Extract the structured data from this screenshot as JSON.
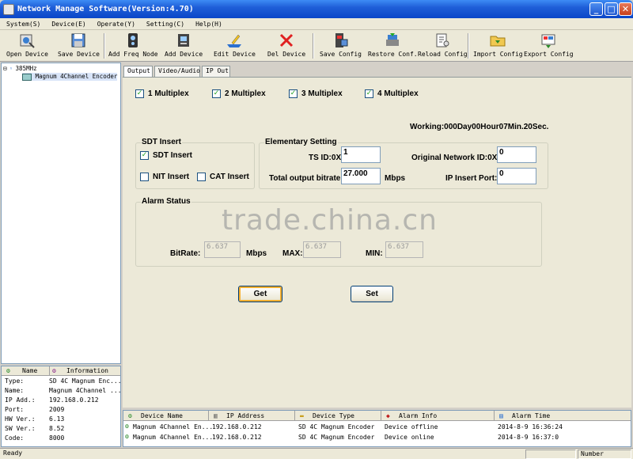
{
  "window": {
    "title": "Network Manage Software(Version:4.70)",
    "controls": [
      "_",
      "□",
      "✕"
    ]
  },
  "menu": [
    "System(S)",
    "Device(E)",
    "Operate(Y)",
    "Setting(C)",
    "Help(H)"
  ],
  "toolbar": [
    {
      "label": "Open Device",
      "icon": "open-device-icon"
    },
    {
      "label": "Save Device",
      "icon": "save-device-icon"
    },
    {
      "label": "Add Freq Node",
      "icon": "add-freq-node-icon"
    },
    {
      "label": "Add Device",
      "icon": "add-device-icon"
    },
    {
      "label": "Edit Device",
      "icon": "edit-device-icon"
    },
    {
      "label": "Del Device",
      "icon": "delete-icon"
    },
    {
      "label": "Save Config",
      "icon": "save-config-icon"
    },
    {
      "label": "Restore Conf.",
      "icon": "restore-config-icon"
    },
    {
      "label": "Reload Config",
      "icon": "reload-config-icon"
    },
    {
      "label": "Import Config",
      "icon": "import-config-icon"
    },
    {
      "label": "Export Config",
      "icon": "export-config-icon"
    }
  ],
  "tree": {
    "root": "385MHz",
    "child": "Magnum 4Channel Encoder",
    "expander": "⊟"
  },
  "info": {
    "col_name": "Name",
    "col_info": "Information",
    "rows": [
      {
        "name": "Type:",
        "value": "SD 4C Magnum Enc..."
      },
      {
        "name": "Name:",
        "value": "Magnum 4Channel ..."
      },
      {
        "name": "IP Add.:",
        "value": "192.168.0.212"
      },
      {
        "name": "Port:",
        "value": "2009"
      },
      {
        "name": "HW Ver.:",
        "value": "6.13"
      },
      {
        "name": "SW Ver.:",
        "value": "8.52"
      },
      {
        "name": "Code:",
        "value": "8000"
      }
    ]
  },
  "tabs": [
    "Output",
    "Video/Audio",
    "IP Out"
  ],
  "output": {
    "multiplex": [
      {
        "label": "1 Multiplex",
        "checked": true
      },
      {
        "label": "2 Multiplex",
        "checked": true
      },
      {
        "label": "3 Multiplex",
        "checked": true
      },
      {
        "label": "4 Multiplex",
        "checked": true
      }
    ],
    "working": "Working:000Day00Hour07Min.20Sec.",
    "sdt_group": "SDT Insert",
    "sdt_insert": {
      "label": "SDT Insert",
      "checked": true
    },
    "nit_insert": {
      "label": "NIT Insert",
      "checked": false
    },
    "cat_insert": {
      "label": "CAT Insert",
      "checked": false
    },
    "elem_group": "Elementary Setting",
    "ts_id_label": "TS ID:0X",
    "ts_id_value": "1",
    "onid_label": "Original Network ID:0X",
    "onid_value": "0",
    "bitrate_label": "Total output bitrate:",
    "bitrate_value": "27.000",
    "bitrate_unit": "Mbps",
    "ip_port_label": "IP Insert Port:",
    "ip_port_value": "0",
    "alarm_group": "Alarm Status",
    "rate_label": "BitRate:",
    "rate_value": "6.637",
    "rate_unit": "Mbps",
    "max_label": "MAX:",
    "max_value": "6.637",
    "min_label": "MIN:",
    "min_value": "6.637",
    "get_button": "Get",
    "set_button": "Set"
  },
  "watermark": "trade.china.cn",
  "log": {
    "columns": [
      "Device Name",
      "IP Address",
      "Device Type",
      "Alarm Info",
      "Alarm Time"
    ],
    "rows": [
      [
        "Magnum 4Channel En...",
        "192.168.0.212",
        "SD 4C Magnum Encoder",
        "Device offline",
        "2014-8-9 16:36:24"
      ],
      [
        "Magnum 4Channel En...",
        "192.168.0.212",
        "SD 4C Magnum Encoder",
        "Device online",
        "2014-8-9 16:37:0"
      ]
    ]
  },
  "status": {
    "left": "Ready",
    "right": "Number"
  }
}
